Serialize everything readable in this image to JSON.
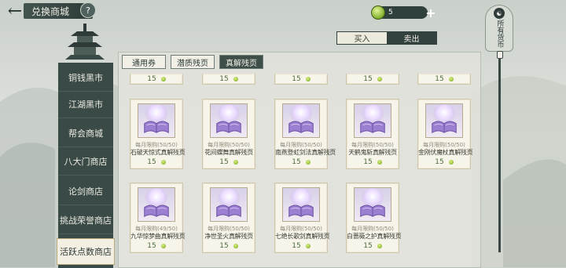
{
  "header": {
    "back_icon": "arrow-left-icon",
    "title": "兑换商城",
    "help_label": "?",
    "currency_amount": "5",
    "plus_label": "+"
  },
  "trade_tabs": {
    "buy": "买入",
    "sell": "卖出",
    "active": "sell"
  },
  "shop_badge": {
    "label": "所有货币"
  },
  "sidebar": {
    "items": [
      {
        "label": "铜钱黑市"
      },
      {
        "label": "江湖黑市"
      },
      {
        "label": "帮会商城"
      },
      {
        "label": "八大门商店"
      },
      {
        "label": "论剑商店"
      },
      {
        "label": "挑战荣誉商店"
      },
      {
        "label": "活跃点数商店",
        "active": true
      }
    ]
  },
  "category_tabs": [
    {
      "label": "通用券"
    },
    {
      "label": "潜质残页"
    },
    {
      "label": "真解残页",
      "active": true
    }
  ],
  "partial_row": [
    {
      "price": "15"
    },
    {
      "price": "15"
    },
    {
      "price": "15"
    },
    {
      "price": "15"
    },
    {
      "price": "15"
    }
  ],
  "items": [
    {
      "limit": "每月限购(50/50)",
      "name": "石破天惊式真解残页",
      "price": "15"
    },
    {
      "limit": "每月限购(50/50)",
      "name": "花间蝶舞真解残页",
      "price": "15"
    },
    {
      "limit": "每月限购(50/50)",
      "name": "南燕登虹剑法真解残页",
      "price": "15"
    },
    {
      "limit": "每月限购(50/50)",
      "name": "天鹤鬼斩真解残页",
      "price": "15"
    },
    {
      "limit": "每月限购(50/50)",
      "name": "金刚伏魔杖真解残页",
      "price": "15"
    },
    {
      "limit": "每月限购(49/50)",
      "name": "九华惊梦曲真解残页",
      "price": "15"
    },
    {
      "limit": "每月限购(50/50)",
      "name": "净世圣火真解残页",
      "price": "15"
    },
    {
      "limit": "每月限购(50/50)",
      "name": "七绝长歌剑真解残页",
      "price": "15"
    },
    {
      "limit": "每月限购(50/50)",
      "name": "白蔷薇之护真解残页",
      "price": "15"
    }
  ],
  "colors": {
    "accent_dark": "#3e4f4a",
    "coin_green": "#7fae2a",
    "card_bg": "#f7f4ea"
  }
}
